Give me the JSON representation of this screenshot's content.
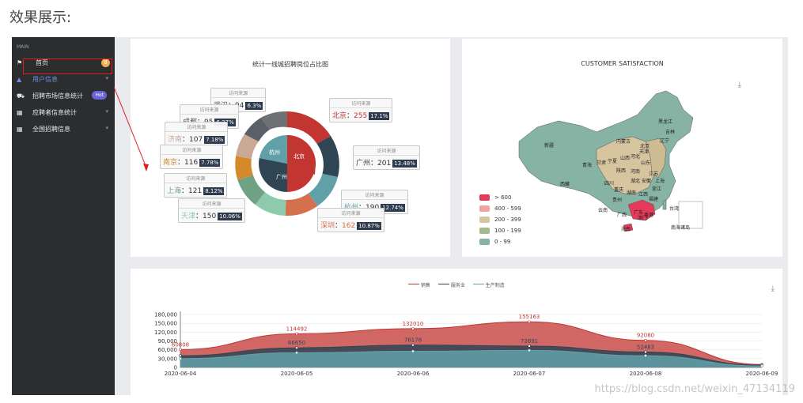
{
  "heading": "效果展示:",
  "sidebar": {
    "caption": "MAIN",
    "items": [
      {
        "label": "首页",
        "badge": "8"
      },
      {
        "label": "用户信息"
      },
      {
        "label": "招聘市场信息统计",
        "badge": "Hot"
      },
      {
        "label": "应聘者信息统计"
      },
      {
        "label": "全国招聘信息"
      }
    ]
  },
  "pie_panel": {
    "title": "统计一线城招聘岗位占比图",
    "inner_labels": [
      "北京",
      "广州",
      "杭州"
    ],
    "tooltip_title": "访问来源",
    "tooltips": [
      {
        "city": "武汉",
        "value": "94",
        "pct": "6.3%",
        "color": "#555555"
      },
      {
        "city": "成都",
        "value": "95",
        "pct": "6.37%",
        "color": "#555555"
      },
      {
        "city": "济南",
        "value": "107",
        "pct": "7.18%",
        "color": "#c9a896"
      },
      {
        "city": "南京",
        "value": "116",
        "pct": "7.78%",
        "color": "#d48a2b"
      },
      {
        "city": "上海",
        "value": "121",
        "pct": "8.12%",
        "color": "#6fa184"
      },
      {
        "city": "天津",
        "value": "150",
        "pct": "10.06%",
        "color": "#8dcbac"
      },
      {
        "city": "北京",
        "value": "255",
        "pct": "17.1%",
        "color": "#c23531"
      },
      {
        "city": "广州",
        "value": "201",
        "pct": "13.48%",
        "color": "#2f4554"
      },
      {
        "city": "杭州",
        "value": "190",
        "pct": "12.74%",
        "color": "#61a0a8"
      },
      {
        "city": "深圳",
        "value": "162",
        "pct": "10.87%",
        "color": "#d4704b"
      }
    ]
  },
  "map_panel": {
    "title": "CUSTOMER SATISFACTION",
    "legend": [
      {
        "label": "> 600",
        "color": "#e53a5a"
      },
      {
        "label": "400 - 599",
        "color": "#eea3a3"
      },
      {
        "label": "200 - 399",
        "color": "#d7c5a0"
      },
      {
        "label": "100 - 199",
        "color": "#a7b88e"
      },
      {
        "label": "0 - 99",
        "color": "#86b3a4"
      }
    ],
    "provinces": [
      "黑龙江",
      "吉林",
      "辽宁",
      "内蒙古",
      "北京",
      "天津",
      "河北",
      "山西",
      "山东",
      "宁夏",
      "甘肃",
      "陕西",
      "河南",
      "江苏",
      "上海",
      "新疆",
      "青海",
      "西藏",
      "四川",
      "重庆",
      "湖北",
      "安徽",
      "浙江",
      "湖南",
      "江西",
      "福建",
      "贵州",
      "云南",
      "广西",
      "广东",
      "台湾",
      "澳门",
      "香港",
      "海南",
      "南海诸岛"
    ]
  },
  "line_panel": {
    "legend": [
      "销售",
      "服务业",
      "生产制造"
    ],
    "colors": [
      "#c23531",
      "#2f4554",
      "#61a0a8"
    ]
  },
  "chart_data": {
    "type": "area",
    "x": [
      "2020-06-04",
      "2020-06-05",
      "2020-06-06",
      "2020-06-07",
      "2020-06-08",
      "2020-06-09"
    ],
    "yticks": [
      "180,000",
      "150,000",
      "120,000",
      "90,000",
      "60,000",
      "30,000",
      "0"
    ],
    "ylim": [
      0,
      180000
    ],
    "series": [
      {
        "name": "销售",
        "values": [
          60808,
          114492,
          132010,
          155163,
          92080,
          10000
        ]
      },
      {
        "name": "服务业",
        "values": [
          40000,
          66650,
          76178,
          72691,
          52483,
          8000
        ]
      },
      {
        "name": "生产制造",
        "values": [
          30000,
          50000,
          55000,
          58000,
          40000,
          5000
        ]
      }
    ],
    "labels": [
      {
        "series": 0,
        "index": 0,
        "text": "60808"
      },
      {
        "series": 0,
        "index": 1,
        "text": "114492"
      },
      {
        "series": 0,
        "index": 2,
        "text": "132010"
      },
      {
        "series": 0,
        "index": 3,
        "text": "155163"
      },
      {
        "series": 0,
        "index": 4,
        "text": "92080"
      },
      {
        "series": 1,
        "index": 1,
        "text": "66650"
      },
      {
        "series": 1,
        "index": 2,
        "text": "76178"
      },
      {
        "series": 1,
        "index": 3,
        "text": "72691"
      },
      {
        "series": 1,
        "index": 4,
        "text": "52483"
      }
    ]
  },
  "watermark": "https://blog.csdn.net/weixin_47134119"
}
